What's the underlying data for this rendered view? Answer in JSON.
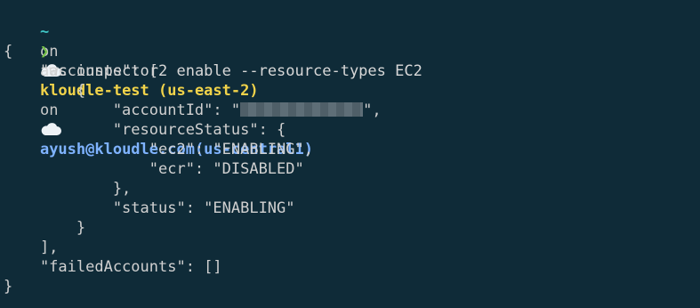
{
  "prompt": {
    "tilde": "~",
    "on1": "on",
    "context": "kloudle-test (us-east-2)",
    "on2": "on",
    "account": "ayush@kloudle.com(us-central1)",
    "cloud_icon": "cloud-icon",
    "chevron": "❯"
  },
  "command": "aws inspector2 enable --resource-types EC2",
  "output": {
    "lines": [
      "{",
      "    \"accounts\": [",
      "        {",
      "            \"accountId\": \"",
      "            \"resourceStatus\": {",
      "                \"ec2\": \"ENABLING\",",
      "                \"ecr\": \"DISABLED\"",
      "            },",
      "            \"status\": \"ENABLING\"",
      "        }",
      "    ],",
      "    \"failedAccounts\": []",
      "}"
    ],
    "account_id_suffix": "\","
  },
  "colors": {
    "background": "#0f2b38",
    "context": "#f1d34a",
    "account": "#7fb3ff",
    "chevron": "#76c24a",
    "tilde": "#3fc4c4"
  }
}
